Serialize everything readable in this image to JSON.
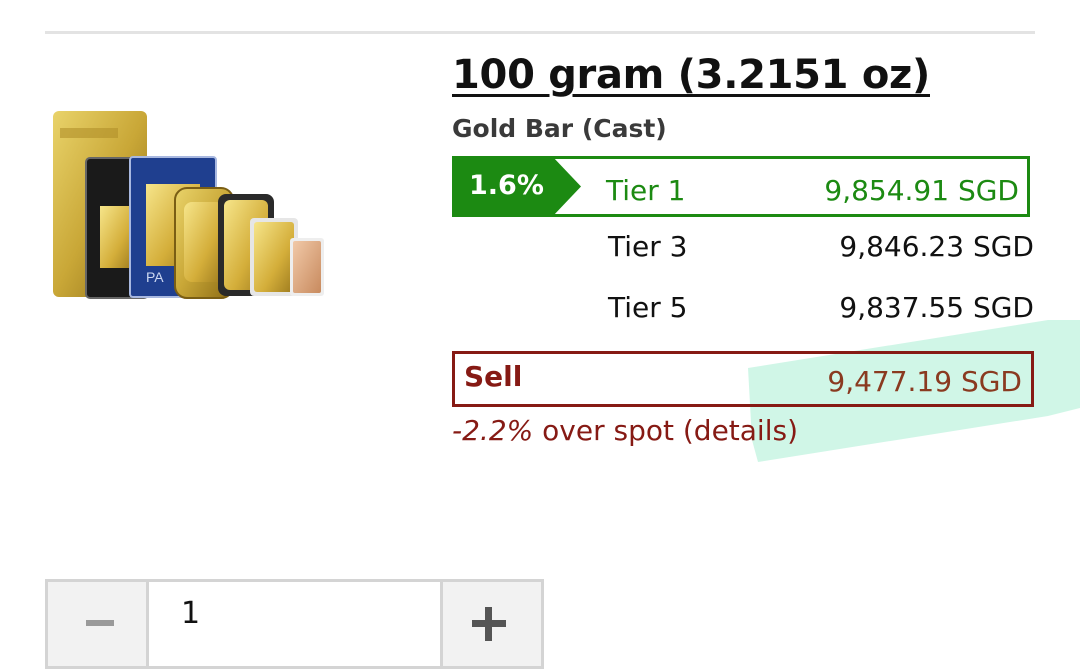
{
  "product": {
    "title": "100 gram (3.2151 oz)",
    "subtitle": "Gold Bar (Cast)",
    "image_icon": "gold-bars-image"
  },
  "pricing": {
    "premium_badge": "1.6%",
    "tiers": [
      {
        "label": "Tier 1",
        "price": "9,854.91 SGD"
      },
      {
        "label": "Tier 3",
        "price": "9,846.23 SGD"
      },
      {
        "label": "Tier 5",
        "price": "9,837.55 SGD"
      }
    ],
    "sell": {
      "label": "Sell",
      "price": "9,477.19 SGD"
    },
    "spot": {
      "percent": "-2.2%",
      "text": " over spot ",
      "details_link": "(details)"
    }
  },
  "quantity": {
    "value": "1",
    "minus_icon": "minus-icon",
    "plus_icon": "plus-icon"
  },
  "colors": {
    "green": "#1c8a12",
    "dark_red": "#861a14",
    "highlight": "#c8f5e3"
  }
}
